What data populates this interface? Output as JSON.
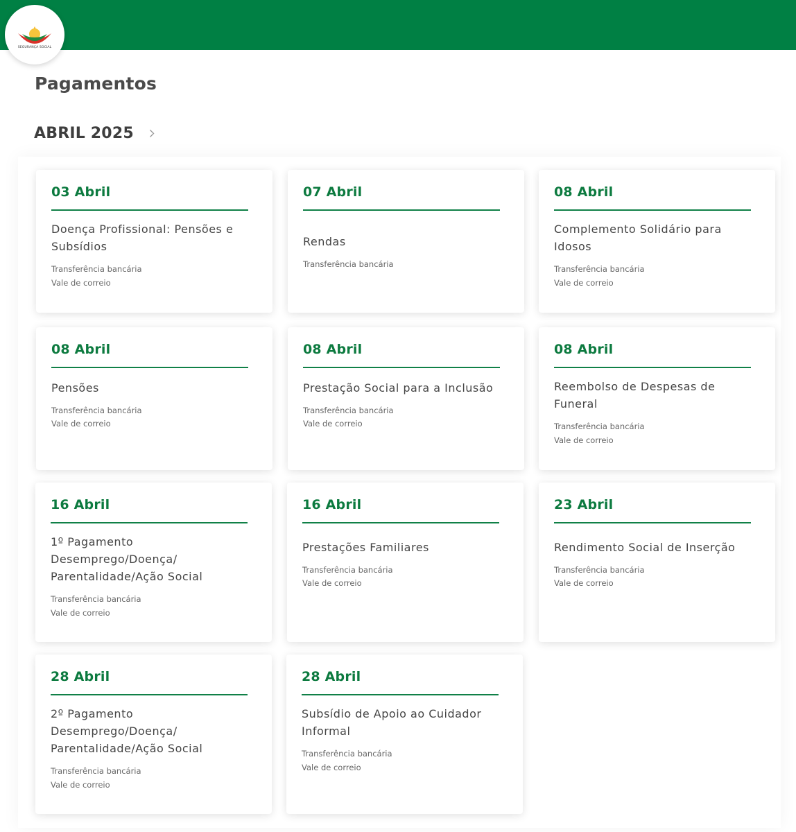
{
  "header": {
    "logo_text": "SEGURANÇA SOCIAL",
    "brand_color": "#008044",
    "accent_color": "#0c7a3f"
  },
  "page": {
    "title": "Pagamentos",
    "month": "ABRIL 2025",
    "next_icon": "chevron-right-icon"
  },
  "payments": [
    {
      "date": "03 Abril",
      "title": "Doença Profissional: Pensões e Subsídios",
      "methods": [
        "Transferência bancária",
        "Vale de correio"
      ]
    },
    {
      "date": "07 Abril",
      "title": "Rendas",
      "methods": [
        "Transferência bancária"
      ]
    },
    {
      "date": "08 Abril",
      "title": "Complemento Solidário para Idosos",
      "methods": [
        "Transferência bancária",
        "Vale de correio"
      ]
    },
    {
      "date": "08 Abril",
      "title": "Pensões",
      "methods": [
        "Transferência bancária",
        "Vale de correio"
      ]
    },
    {
      "date": "08 Abril",
      "title": "Prestação Social para a Inclusão",
      "methods": [
        "Transferência bancária",
        "Vale de correio"
      ]
    },
    {
      "date": "08 Abril",
      "title": "Reembolso de Despesas de Funeral",
      "methods": [
        "Transferência bancária",
        "Vale de correio"
      ]
    },
    {
      "date": "16 Abril",
      "title": "1º Pagamento Desemprego/Doença/ Parentalidade/Ação Social",
      "methods": [
        "Transferência bancária",
        "Vale de correio"
      ]
    },
    {
      "date": "16 Abril",
      "title": "Prestações Familiares",
      "methods": [
        "Transferência bancária",
        "Vale de correio"
      ]
    },
    {
      "date": "23 Abril",
      "title": "Rendimento Social de Inserção",
      "methods": [
        "Transferência bancária",
        "Vale de correio"
      ]
    },
    {
      "date": "28 Abril",
      "title": "2º Pagamento Desemprego/Doença/ Parentalidade/Ação Social",
      "methods": [
        "Transferência bancária",
        "Vale de correio"
      ]
    },
    {
      "date": "28 Abril",
      "title": "Subsídio de Apoio ao Cuidador Informal",
      "methods": [
        "Transferência bancária",
        "Vale de correio"
      ]
    }
  ]
}
